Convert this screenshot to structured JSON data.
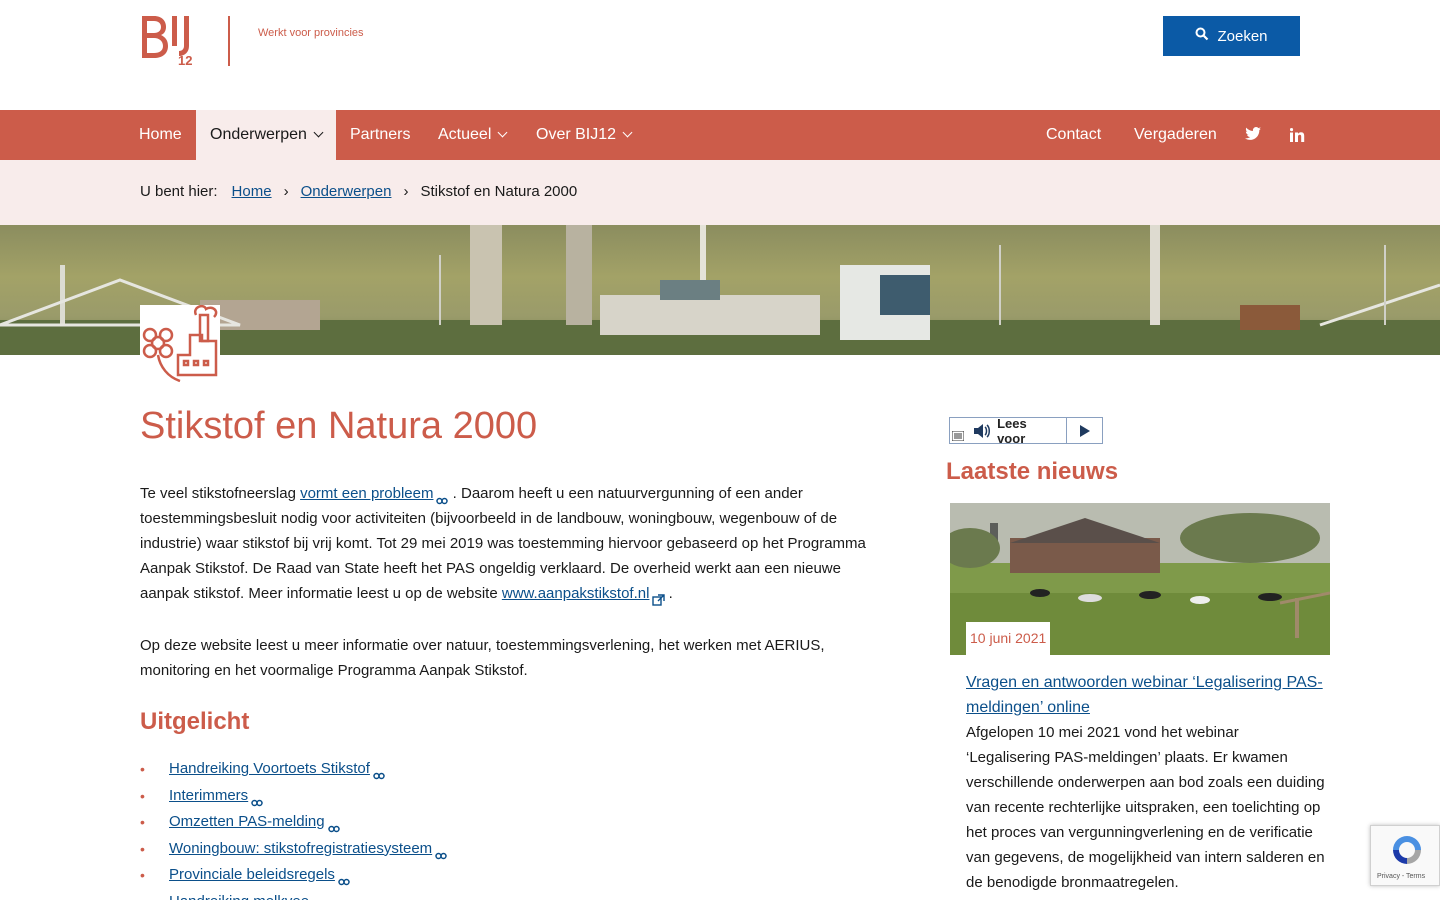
{
  "header": {
    "tagline": "Werkt voor provincies",
    "search_label": "Zoeken"
  },
  "nav": {
    "items": [
      "Home",
      "Onderwerpen",
      "Partners",
      "Actueel",
      "Over BIJ12"
    ],
    "right_items": [
      "Contact",
      "Vergaderen"
    ]
  },
  "breadcrumb": {
    "prefix": "U bent hier:",
    "items": [
      "Home",
      "Onderwerpen",
      "Stikstof en Natura 2000"
    ]
  },
  "main": {
    "title": "Stikstof en Natura 2000",
    "intro_before": "Te veel stikstofneerslag ",
    "intro_link": "vormt een probleem",
    "intro_after": " . Daarom heeft u een natuurvergunning of een ander toestemmingsbesluit nodig voor activiteiten (bijvoorbeeld in de landbouw, woningbouw, wegenbouw of de industrie) waar stikstof bij vrij komt. Tot 29 mei 2019 was toestemming hiervoor gebaseerd op het Programma Aanpak Stikstof. De Raad van State heeft het PAS ongeldig verklaard. De overheid werkt aan een nieuwe aanpak stikstof. Meer informatie leest u op de website ",
    "website_link": "www.aanpakstikstof.nl",
    "intro_end": " .",
    "second_paragraph": "Op deze website leest u meer informatie over natuur, toestemmingsverlening, het werken met AERIUS, monitoring en het voormalige Programma Aanpak Stikstof.",
    "uitgelicht_title": "Uitgelicht",
    "uitgelicht_items": [
      "Handreiking Voortoets Stikstof",
      "Interimmers",
      "Omzetten PAS-melding",
      "Woningbouw: stikstofregistratiesysteem",
      "Provinciale beleidsregels",
      "Handreiking melkvee"
    ]
  },
  "sidebar": {
    "readspeaker_label": "Lees voor",
    "news_title": "Laatste nieuws",
    "news_date": "10 juni 2021",
    "news_link": "Vragen en antwoorden webinar ‘Legalisering PAS-meldingen’ online",
    "news_text": "Afgelopen 10 mei 2021 vond het webinar ‘Legalisering PAS-meldingen’ plaats. Er kwamen verschillende onderwerpen aan bod zoals een duiding van recente rechterlijke uitspraken, een toelichting op het proces van vergunningverlening en de verificatie van gegevens, de mogelijkheid van intern salderen en de benodigde bronmaatregelen."
  },
  "recaptcha": {
    "text": "Privacy - Terms"
  },
  "colors": {
    "brand": "#cc5c4a",
    "brand_light": "#f8eceb",
    "link": "#0b4f8a",
    "button": "#0b5aa6"
  }
}
